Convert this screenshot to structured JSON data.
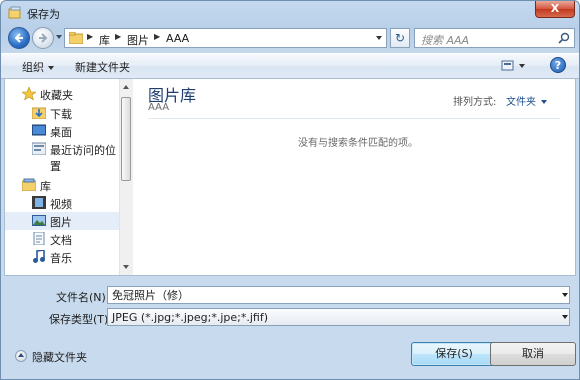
{
  "window": {
    "title": "保存为",
    "close_symbol": "X"
  },
  "navigation": {
    "breadcrumbs": [
      "库",
      "图片",
      "AAA"
    ],
    "search_placeholder": "搜索 AAA",
    "refresh_symbol": "↻"
  },
  "toolbar": {
    "organize_label": "组织",
    "new_folder_label": "新建文件夹",
    "help_symbol": "?"
  },
  "sidebar": {
    "items": [
      {
        "label": "收藏夹",
        "icon": "star-icon"
      },
      {
        "label": "下载",
        "icon": "download-folder-icon"
      },
      {
        "label": "桌面",
        "icon": "desktop-icon"
      },
      {
        "label": "最近访问的位置",
        "icon": "recent-places-icon"
      },
      {
        "label": "库",
        "icon": "library-icon"
      },
      {
        "label": "视频",
        "icon": "video-icon"
      },
      {
        "label": "图片",
        "icon": "pictures-icon",
        "selected": true
      },
      {
        "label": "文档",
        "icon": "documents-icon"
      },
      {
        "label": "音乐",
        "icon": "music-icon"
      }
    ]
  },
  "content": {
    "library_title": "图片库",
    "library_subtitle": "AAA",
    "arrange_label": "排列方式:",
    "arrange_value": "文件夹",
    "empty_message": "没有与搜索条件匹配的项。"
  },
  "form": {
    "filename_label": "文件名(N):",
    "filename_value": "免冠照片（修）",
    "filetype_label": "保存类型(T):",
    "filetype_value": "JPEG (*.jpg;*.jpeg;*.jpe;*.jfif)"
  },
  "footer": {
    "hide_folders_label": "隐藏文件夹",
    "save_label": "保存(S)",
    "cancel_label": "取消"
  },
  "colors": {
    "accent": "#1e3e6e",
    "title_bar": "#c4d9ef",
    "close_button": "#c0391f"
  }
}
